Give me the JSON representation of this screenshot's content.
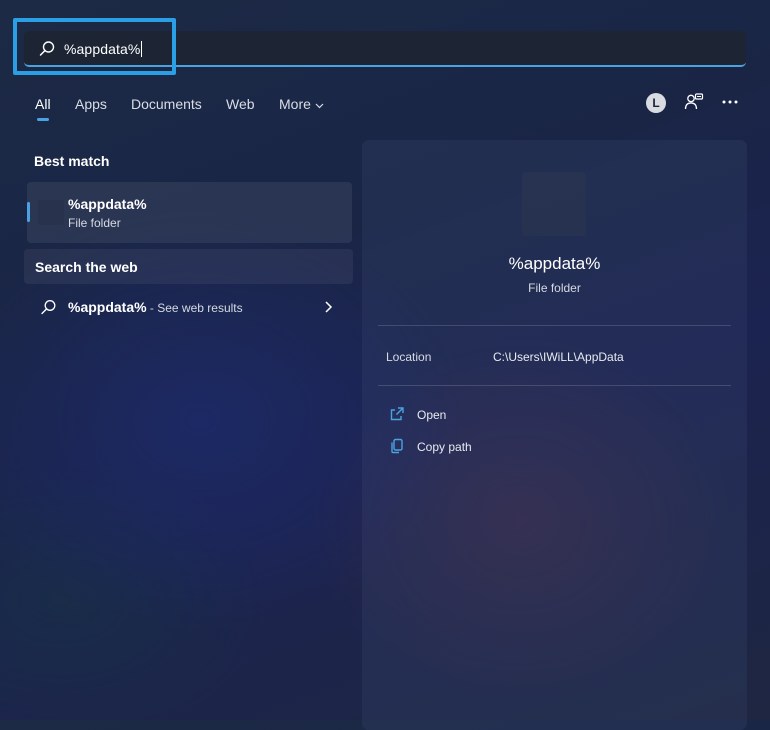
{
  "search": {
    "query": "%appdata%"
  },
  "tabs": [
    {
      "label": "All"
    },
    {
      "label": "Apps"
    },
    {
      "label": "Documents"
    },
    {
      "label": "Web"
    },
    {
      "label": "More"
    }
  ],
  "header_right": {
    "avatar_letter": "L"
  },
  "best_match": {
    "heading": "Best match",
    "item": {
      "title": "%appdata%",
      "subtitle": "File folder"
    }
  },
  "search_web": {
    "heading": "Search the web",
    "query": "%appdata%",
    "suffix": " - See web results"
  },
  "detail": {
    "title": "%appdata%",
    "subtitle": "File folder",
    "location_label": "Location",
    "location_value": "C:\\Users\\IWiLL\\AppData",
    "actions": [
      {
        "label": "Open"
      },
      {
        "label": "Copy path"
      }
    ]
  },
  "colors": {
    "accent": "#4aa3e0",
    "highlight": "#2a9fe6"
  }
}
